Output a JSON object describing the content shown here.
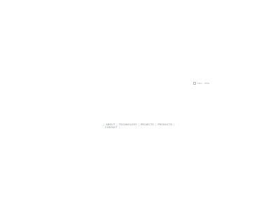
{
  "language": {
    "code_label": "LNG · ENG"
  },
  "nav": {
    "separator": "|",
    "line1": [
      {
        "label": "ABOUT"
      },
      {
        "label": "TECHNOLOGY"
      },
      {
        "label": "PROJECTS"
      },
      {
        "label": "PRODUCTS"
      }
    ],
    "line2": [
      {
        "label": "CONTACT"
      }
    ]
  }
}
